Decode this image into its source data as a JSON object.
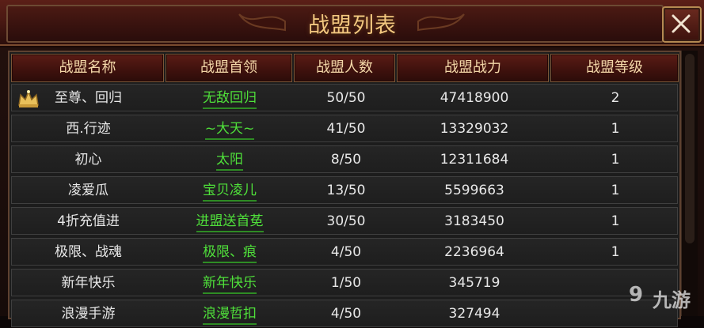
{
  "window": {
    "title": "战盟列表",
    "close_label": "✕"
  },
  "table": {
    "headers": [
      "战盟名称",
      "战盟首领",
      "战盟人数",
      "战盟战力",
      "战盟等级"
    ],
    "rows": [
      {
        "name": "至尊、回归",
        "leader": "无敌回归",
        "members": "50/50",
        "power": "47418900",
        "level": "2",
        "crown": true
      },
      {
        "name": "西.行迹",
        "leader": "~大天~",
        "members": "41/50",
        "power": "13329032",
        "level": "1"
      },
      {
        "name": "初心",
        "leader": "太阳",
        "members": "8/50",
        "power": "12311684",
        "level": "1"
      },
      {
        "name": "凌爱瓜",
        "leader": "宝贝凌儿",
        "members": "13/50",
        "power": "5599663",
        "level": "1"
      },
      {
        "name": "4折充值进",
        "leader": "进盟送首莬",
        "members": "30/50",
        "power": "3183450",
        "level": "1"
      },
      {
        "name": "极限、战魂",
        "leader": "极限、痕",
        "members": "4/50",
        "power": "2236964",
        "level": "1"
      },
      {
        "name": "新年快乐",
        "leader": "新年快乐",
        "members": "1/50",
        "power": "345719",
        "level": ""
      },
      {
        "name": "浪漫手游",
        "leader": "浪漫哲扣",
        "members": "4/50",
        "power": "327494",
        "level": ""
      }
    ]
  },
  "icons": {
    "crown": "crown-icon",
    "close": "close-icon"
  },
  "colors": {
    "title": "#f2c77f",
    "leader": "#4fe03a",
    "header_bg": "#4a1913"
  },
  "watermark": {
    "logo": "9",
    "text": "九游"
  }
}
